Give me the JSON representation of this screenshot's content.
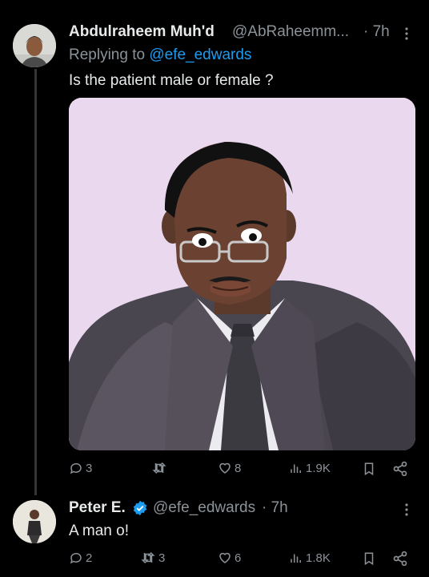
{
  "tweet1": {
    "display_name": "Abdulraheem Muh'd",
    "handle": "@AbRaheemm...",
    "time": "· 7h",
    "replying_prefix": "Replying to",
    "replying_mention": "@efe_edwards",
    "text": "Is the patient male or female ?",
    "stats": {
      "replies": "3",
      "retweets": "",
      "likes": "8",
      "views": "1.9K"
    }
  },
  "tweet2": {
    "display_name": "Peter E.",
    "handle": "@efe_edwards",
    "time": "· 7h",
    "text": "A man o!",
    "stats": {
      "replies": "2",
      "retweets": "3",
      "likes": "6",
      "views": "1.8K"
    }
  },
  "colors": {
    "background": "#000000",
    "text": "#e7e9ea",
    "muted": "#8b9298",
    "accent": "#1d9bf0",
    "media_background": "#ead8ef"
  }
}
